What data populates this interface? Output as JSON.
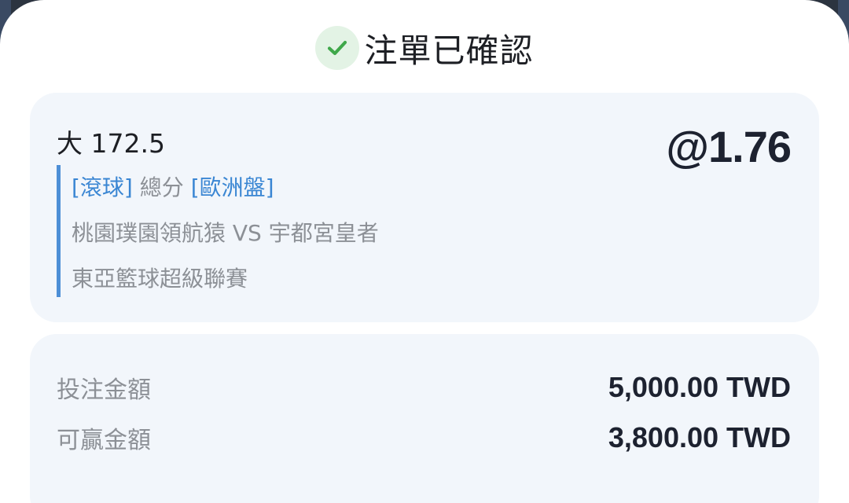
{
  "header": {
    "title": "注單已確認",
    "check_color": "#3fa84a"
  },
  "bet": {
    "selection": "大 172.5",
    "odds": "@1.76",
    "tag_live": "[滾球]",
    "market": "總分",
    "tag_odds_type": "[歐洲盤]",
    "match": "桃園璞園領航猿 VS 宇都宮皇者",
    "league": "東亞籃球超級聯賽"
  },
  "summary": {
    "stake_label": "投注金額",
    "stake_value": "5,000.00 TWD",
    "win_label": "可贏金額",
    "win_value": "3,800.00 TWD"
  }
}
